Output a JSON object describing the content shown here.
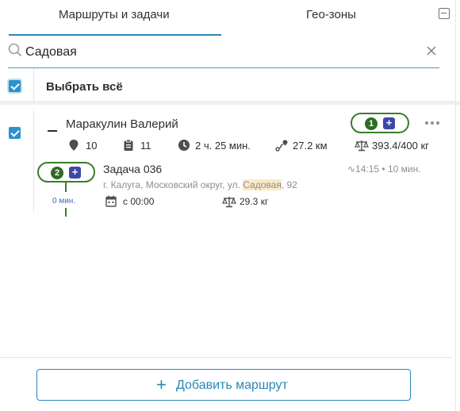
{
  "tabs": [
    {
      "label": "Маршруты и задачи",
      "active": true
    },
    {
      "label": "Гео-зоны",
      "active": false
    }
  ],
  "search": {
    "value": "Садовая",
    "icon": "search-icon"
  },
  "select_all": {
    "label": "Выбрать всё",
    "checked": true
  },
  "route": {
    "checked": true,
    "driver": "Маракулин Валерий",
    "badge_number": "1",
    "plus": "+",
    "stats": {
      "points": "10",
      "tasks": "11",
      "duration": "2 ч. 25 мин.",
      "distance": "27.2 км",
      "weight": "393.4/400 кг"
    }
  },
  "task": {
    "badge_number": "2",
    "plus": "+",
    "title": "Задача 036",
    "address_before": "г. Калуга, Московский округ, ул. ",
    "address_highlight": "Садовая",
    "address_after": ", 92",
    "time": "∿14:15 • 10 мин.",
    "duration": "0 мин.",
    "window": "с 00:00",
    "weight": "29.3 кг"
  },
  "footer": {
    "add_route_label": "Добавить маршрут",
    "plus": "+"
  },
  "colors": {
    "accent": "#2a86b6",
    "checkbox": "#2a93cc",
    "route_green": "#3a7d2a",
    "plus_badge": "#3d48a8",
    "highlight": "#fbeac6"
  }
}
